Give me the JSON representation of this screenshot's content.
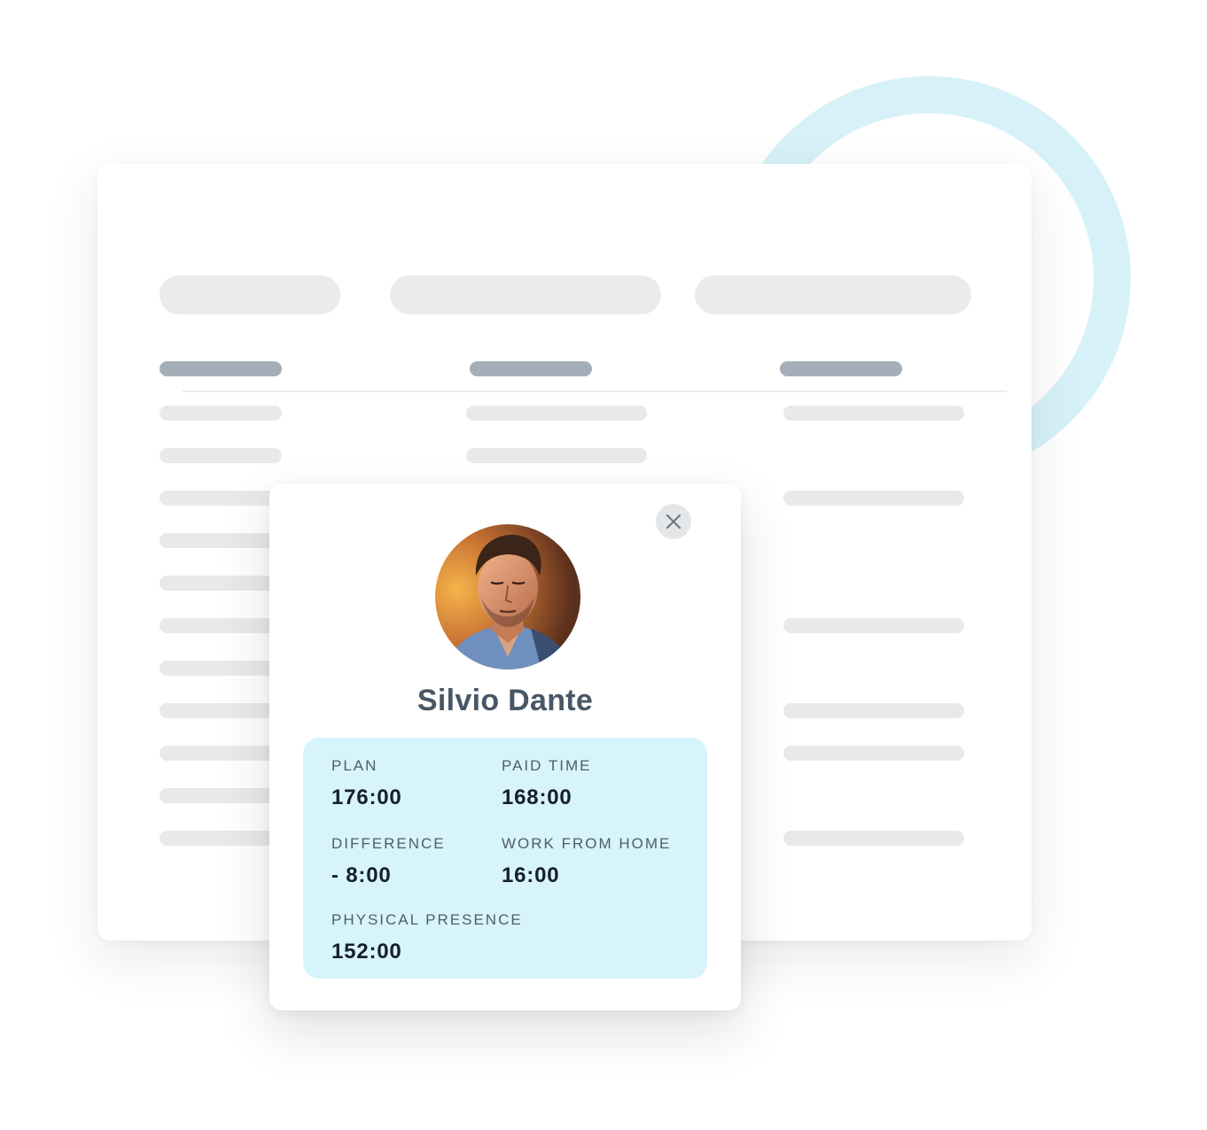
{
  "profile": {
    "name": "Silvio Dante",
    "avatar_alt": "Silvio Dante"
  },
  "stats": {
    "plan": {
      "label": "PLAN",
      "value": "176:00"
    },
    "paid_time": {
      "label": "PAID TIME",
      "value": "168:00"
    },
    "difference": {
      "label": "DIFFERENCE",
      "value": "- 8:00"
    },
    "work_from_home": {
      "label": "WORK FROM HOME",
      "value": "16:00"
    },
    "physical_presence": {
      "label": "PHYSICAL PRESENCE",
      "value": "152:00"
    }
  },
  "icons": {
    "close": "close-icon",
    "avatar": "user-photo"
  },
  "colors": {
    "accent_light": "#d7f3fb",
    "ring": "#d7f1f9",
    "name_text": "#485766",
    "value_text": "#15202b",
    "header_placeholder": "#a3aeb8",
    "row_placeholder": "#e9e9e9"
  }
}
